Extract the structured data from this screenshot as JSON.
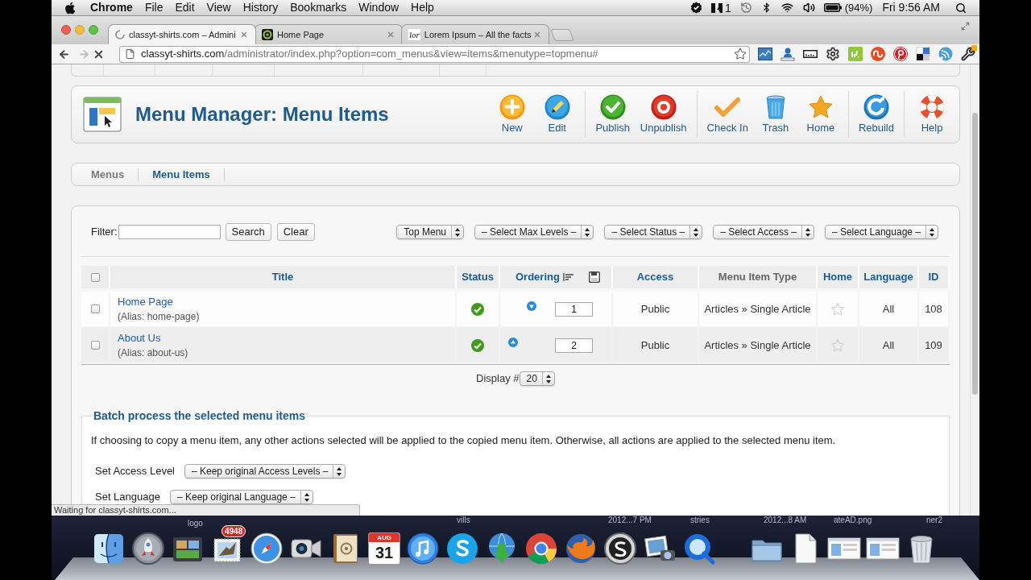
{
  "menu_bar": {
    "app": "Chrome",
    "menus": [
      "File",
      "Edit",
      "View",
      "History",
      "Bookmarks",
      "Window",
      "Help"
    ],
    "status_items": [
      {
        "kind": "check_badge"
      },
      {
        "kind": "adobe",
        "count": "1"
      },
      {
        "kind": "time_machine"
      },
      {
        "kind": "bluetooth"
      },
      {
        "kind": "wifi"
      },
      {
        "kind": "volume"
      },
      {
        "kind": "battery",
        "reading": "(94%)"
      }
    ],
    "clock": "Fri 9:56 AM"
  },
  "browser": {
    "tabs": [
      {
        "title": "classyt-shirts.com – Admini",
        "selected": true,
        "kind": "spinner"
      },
      {
        "title": "Home Page",
        "selected": false,
        "kind": "ring"
      },
      {
        "title": "Lorem Ipsum – All the facts",
        "selected": false,
        "kind": "letters",
        "favicon_text": "lor"
      }
    ],
    "loading": true,
    "url": {
      "host": "classyt-shirts.com",
      "path": "/administrator/index.php?option=com_menus&view=items&menutype=topmenu#"
    },
    "extensions": [
      {
        "kind": "chart"
      },
      {
        "kind": "uploader"
      },
      {
        "kind": "keyboard"
      },
      {
        "kind": "gear"
      },
      {
        "kind": "green_square"
      },
      {
        "kind": "stumble"
      },
      {
        "kind": "pin"
      },
      {
        "kind": "squares"
      },
      {
        "kind": "feed"
      },
      {
        "kind": "wrench"
      }
    ]
  },
  "page": {
    "toolbar": {
      "title": "Menu Manager: Menu Items",
      "groups": [
        {
          "buttons": [
            {
              "label": "New",
              "kind": "new"
            },
            {
              "label": "Edit",
              "kind": "edit"
            }
          ]
        },
        {
          "buttons": [
            {
              "label": "Publish",
              "kind": "publish"
            },
            {
              "label": "Unpublish",
              "kind": "unpublish"
            }
          ]
        },
        {
          "buttons": [
            {
              "label": "Check In",
              "kind": "checkin"
            },
            {
              "label": "Trash",
              "kind": "trash"
            },
            {
              "label": "Home",
              "kind": "home"
            }
          ]
        },
        {
          "buttons": [
            {
              "label": "Rebuild",
              "kind": "rebuild"
            }
          ]
        },
        {
          "buttons": [
            {
              "label": "Help",
              "kind": "help"
            }
          ]
        }
      ]
    },
    "submenu": [
      {
        "label": "Menus",
        "selected": false
      },
      {
        "label": "Menu Items",
        "selected": true
      }
    ],
    "filter": {
      "label": "Filter:",
      "search": "Search",
      "clear": "Clear",
      "selects": [
        "Top Menu",
        "– Select Max Levels –",
        "– Select Status –",
        "– Select Access –",
        "– Select Language –"
      ]
    },
    "table": {
      "select_all_checked": false,
      "columns": [
        {
          "label": "Title",
          "kind": "link"
        },
        {
          "label": "Status",
          "kind": "link"
        },
        {
          "label": "Ordering",
          "kind": "ordering"
        },
        {
          "label": "Access",
          "kind": "link"
        },
        {
          "label": "Menu Item Type",
          "kind": "plain"
        },
        {
          "label": "Home",
          "kind": "link"
        },
        {
          "label": "Language",
          "kind": "link"
        },
        {
          "label": "ID",
          "kind": "link"
        }
      ],
      "rows": [
        {
          "checked": false,
          "title": "Home Page",
          "alias": "(Alias: home-page)",
          "published": true,
          "move_up": false,
          "move_down": true,
          "order": "1",
          "access": "Public",
          "type": "Articles » Single Article",
          "home": false,
          "language": "All",
          "id": "108"
        },
        {
          "checked": false,
          "title": "About Us",
          "alias": "(Alias: about-us)",
          "published": true,
          "move_up": true,
          "move_down": false,
          "order": "2",
          "access": "Public",
          "type": "Articles » Single Article",
          "home": false,
          "language": "All",
          "id": "109"
        }
      ]
    },
    "display": {
      "label": "Display #",
      "value": "20"
    },
    "batch": {
      "legend": "Batch process the selected menu items",
      "note": "If choosing to copy a menu item, any other actions selected will be applied to the copied menu item. Otherwise, all actions are applied to the selected menu item.",
      "fields": [
        {
          "label": "Set Access Level",
          "value": "– Keep original Access Levels –"
        },
        {
          "label": "Set Language",
          "value": "– Keep original Language –"
        }
      ]
    }
  },
  "status_bubble": "Waiting for classyt-shirts.com...",
  "dock": {
    "desktop_labels": [
      "logo",
      "vills",
      "2012...7 PM",
      "stries",
      "2012...8 AM",
      "ateAD.png",
      "ner2"
    ],
    "apps": [
      {
        "kind": "finder"
      },
      {
        "kind": "launchpad"
      },
      {
        "kind": "photos"
      },
      {
        "kind": "mail",
        "badge": "4948"
      },
      {
        "kind": "safari"
      },
      {
        "kind": "facetime"
      },
      {
        "kind": "contacts"
      },
      {
        "kind": "calendar",
        "month": "AUG",
        "day": "31"
      },
      {
        "kind": "music"
      },
      {
        "kind": "skype"
      },
      {
        "kind": "download"
      },
      {
        "kind": "chrome"
      },
      {
        "kind": "firefox"
      },
      {
        "kind": "s_app"
      },
      {
        "kind": "iphoto"
      },
      {
        "kind": "quicktime"
      }
    ],
    "stacks": [
      {
        "kind": "folder"
      },
      {
        "kind": "document"
      },
      {
        "kind": "window"
      },
      {
        "kind": "window"
      },
      {
        "kind": "trash"
      }
    ]
  }
}
